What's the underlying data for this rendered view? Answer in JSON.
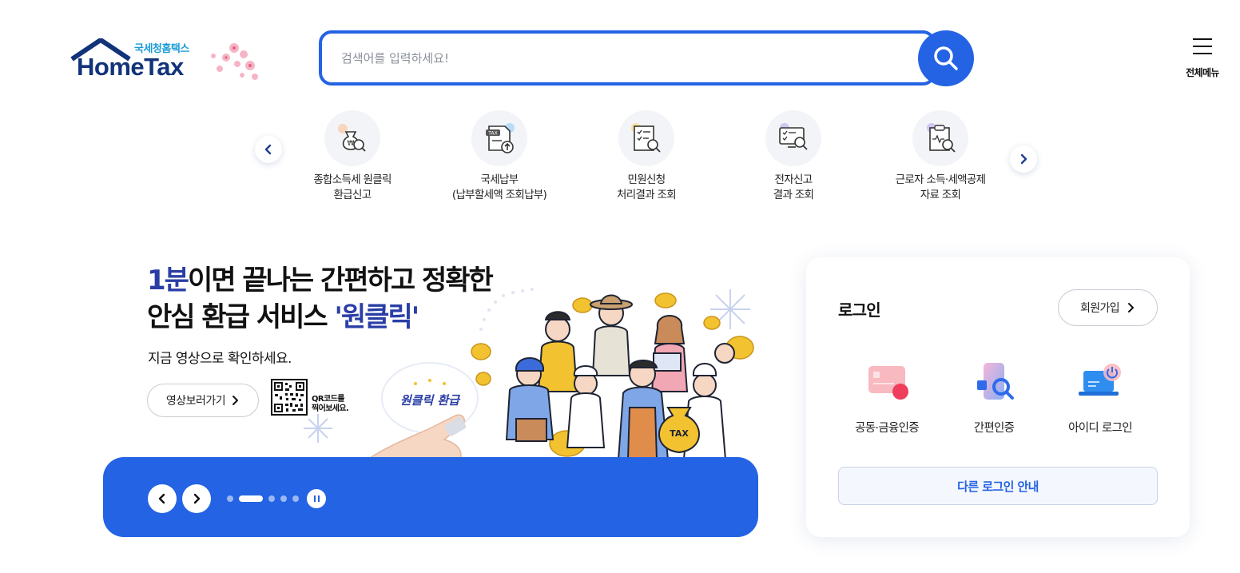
{
  "header": {
    "logo_sub": "국세청홈택스",
    "logo_main": "HomeTax",
    "search_placeholder": "검색어를 입력하세요!",
    "all_menu_label": "전체메뉴"
  },
  "quick_menu": {
    "items": [
      {
        "label": "종합소득세 원클릭\n환급신고",
        "icon": "money-bag-search-icon"
      },
      {
        "label": "국세납부\n(납부할세액 조회납부)",
        "icon": "tax-document-upload-icon"
      },
      {
        "label": "민원신청\n처리결과 조회",
        "icon": "checklist-search-icon"
      },
      {
        "label": "전자신고\n결과 조회",
        "icon": "monitor-search-icon"
      },
      {
        "label": "근로자 소득·세액공제\n자료 조회",
        "icon": "clipboard-search-icon"
      }
    ]
  },
  "banner": {
    "title_highlight_1": "1분",
    "title_line1_rest": "이면 끝나는 간편하고 정확한",
    "title_line2_start": "안심 환급 서비스 ",
    "title_highlight_2": "'원클릭'",
    "subtitle": "지금 영상으로 확인하세요.",
    "video_button": "영상보러가기",
    "qr_text": "QR코드를\n찍어보세요.",
    "badge_text": "원클릭 환급",
    "tax_bag_text": "TAX"
  },
  "carousel": {
    "slide_count": 5,
    "active_index": 1
  },
  "login": {
    "title": "로그인",
    "join_button": "회원가입",
    "methods": [
      {
        "label": "공동·금융인증",
        "icon": "certificate-card-icon"
      },
      {
        "label": "간편인증",
        "icon": "phone-search-icon"
      },
      {
        "label": "아이디 로그인",
        "icon": "laptop-power-icon"
      }
    ],
    "other_login_button": "다른 로그인 안내"
  },
  "colors": {
    "primary": "#2463e4",
    "navy": "#12337a",
    "highlight": "#2a3ea6"
  }
}
